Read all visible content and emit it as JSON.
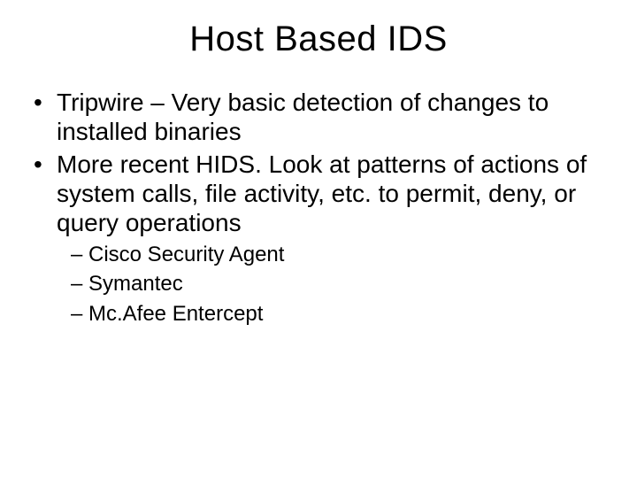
{
  "title": "Host Based IDS",
  "bullets": [
    {
      "text": "Tripwire – Very basic detection of changes to installed binaries"
    },
    {
      "text": "More recent HIDS.  Look at patterns of actions of system calls, file activity, etc. to permit, deny, or query operations"
    }
  ],
  "sub_bullets": [
    {
      "text": "Cisco Security Agent"
    },
    {
      "text": "Symantec"
    },
    {
      "text": "Mc.Afee Entercept"
    }
  ]
}
